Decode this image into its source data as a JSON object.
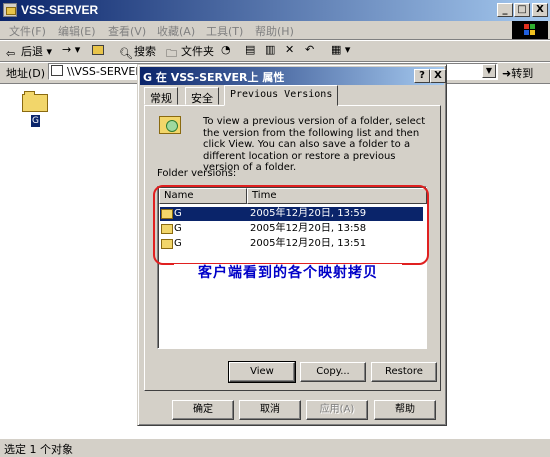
{
  "window": {
    "title": "VSS-SERVER",
    "min_label": "_",
    "max_label": "□",
    "close_label": "X"
  },
  "menu": [
    "文件(F)",
    "编辑(E)",
    "查看(V)",
    "收藏(A)",
    "工具(T)",
    "帮助(H)"
  ],
  "toolbar": {
    "back_label": "后退",
    "forward_label": "→",
    "search_label": "搜索",
    "folders_label": "文件夹"
  },
  "address": {
    "label": "地址(D)",
    "value": "\\\\VSS-SERVER",
    "go_label": "转到"
  },
  "desktop_item": {
    "label": "G"
  },
  "status": {
    "text": "选定 1 个对象"
  },
  "dialog": {
    "title": "G 在 VSS-SERVER上 属性",
    "help_label": "?",
    "close_label": "X",
    "tabs": [
      "常规",
      "安全",
      "Previous Versions"
    ],
    "description": "To view a previous version of a folder, select the version from the following list and then click View.  You can also save a folder to a different location or restore a previous version of a folder.",
    "list_label": "Folder versions:",
    "columns": [
      "Name",
      "Time"
    ],
    "rows": [
      {
        "name": "G",
        "time": "2005年12月20日, 13:59",
        "selected": true
      },
      {
        "name": "G",
        "time": "2005年12月20日, 13:58",
        "selected": false
      },
      {
        "name": "G",
        "time": "2005年12月20日, 13:51",
        "selected": false
      }
    ],
    "view_label": "View",
    "copy_label": "Copy...",
    "restore_label": "Restore",
    "ok_label": "确定",
    "cancel_label": "取消",
    "apply_label": "应用(A)",
    "help_button_label": "帮助"
  },
  "annotation": {
    "text": "客户端看到的各个映射拷贝",
    "color": "#0000c8",
    "border_color": "#e02020"
  }
}
